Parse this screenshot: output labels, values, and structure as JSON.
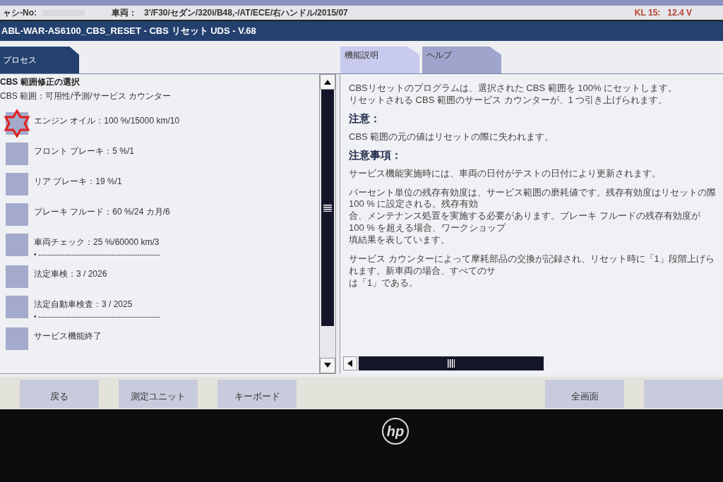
{
  "info_bar": {
    "chassis_label": "ャシ-No:",
    "vehicle_label": "車両：",
    "vehicle_value": "3'/F30/セダン/320i/B48,-/AT/ECE/右ハンドル/2015/07",
    "voltage": "KL 15:   12.4 V"
  },
  "title_bar": {
    "title": "ABL-WAR-AS6100_CBS_RESET - CBS リセット UDS - V.68"
  },
  "left_tab": {
    "label": "プロセス",
    "selected": true
  },
  "right_tabs": [
    {
      "label": "機能説明",
      "selected": true
    },
    {
      "label": "ヘルプ",
      "selected": false
    }
  ],
  "left_panel": {
    "heading": "CBS 範囲修正の選択",
    "subheading": "CBS 範囲：可用性/予測/サービス カウンター",
    "items": [
      {
        "label": "エンジン オイル：100 %/15000 km/10",
        "marked": true
      },
      {
        "label": "フロント ブレーキ：5 %/1",
        "marked": false
      },
      {
        "label": "リア ブレーキ：19 %/1",
        "marked": false
      },
      {
        "label": "ブレーキ フルード：60 %/24 カ月/6",
        "marked": false
      },
      {
        "label": "車両チェック：25 %/60000 km/3",
        "marked": false,
        "note": "•  ----------------------------------------------------"
      },
      {
        "label": "法定車検：3 / 2026",
        "marked": false
      },
      {
        "label": "法定自動車検査：3 / 2025",
        "marked": false,
        "note": "•  ----------------------------------------------------"
      },
      {
        "label": "サービス機能終了",
        "marked": false
      }
    ]
  },
  "right_panel": {
    "blocks": [
      {
        "kind": "text",
        "lines": [
          "CBSリセットのプログラムは、選択された CBS 範囲を 100% にセットします。",
          "リセットされる CBS 範囲のサービス カウンターが、1 つ引き上げられます。"
        ]
      },
      {
        "kind": "heading",
        "text": "注意："
      },
      {
        "kind": "text",
        "lines": [
          "CBS 範囲の元の値はリセットの際に失われます。"
        ]
      },
      {
        "kind": "heading",
        "text": "注意事項："
      },
      {
        "kind": "text",
        "lines": [
          "サービス機能実施時には、車両の日付がテストの日付により更新されます。"
        ]
      },
      {
        "kind": "text",
        "lines": [
          "パーセント単位の残存有効度は、サービス範囲の磨耗値です。残存有効度はリセットの際 100 % に設定される。残存有効",
          "合、メンテナンス処置を実施する必要があります。ブレーキ フルードの残存有効度が 100 % を超える場合、ワークショップ",
          "填結果を表しています。"
        ]
      },
      {
        "kind": "text",
        "lines": [
          "サービス カウンターによって摩耗部品の交換が記録され、リセット時に「1」段階上げられます。新車両の場合、すべてのサ",
          "は「1」である。"
        ]
      }
    ]
  },
  "bottom_buttons": [
    {
      "kind": "button",
      "label": "戻る"
    },
    {
      "kind": "button",
      "label": "測定ユニット"
    },
    {
      "kind": "button",
      "label": "キーボード"
    },
    {
      "kind": "spacer"
    },
    {
      "kind": "button",
      "label": "全画面"
    },
    {
      "kind": "blank"
    }
  ],
  "bezel": {
    "logo": "hp"
  }
}
